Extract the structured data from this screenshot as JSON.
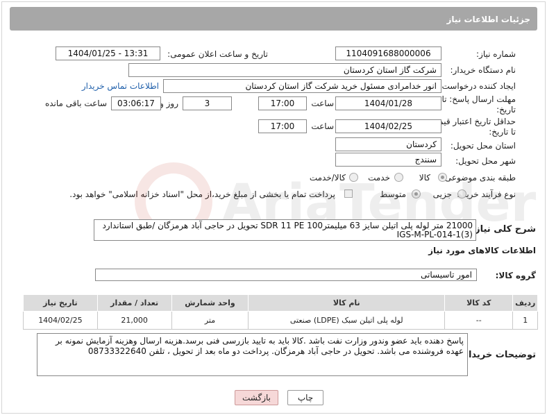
{
  "header": {
    "title": "جزئیات اطلاعات نیاز"
  },
  "fields": {
    "need_number_label": "شماره نیاز:",
    "need_number": "1104091688000006",
    "announce_label": "تاریخ و ساعت اعلان عمومی:",
    "announce_value": "1404/01/25 - 13:31",
    "buyer_org_label": "نام دستگاه خریدار:",
    "buyer_org": "شرکت گاز استان کردستان",
    "creator_label": "ایجاد کننده درخواست:",
    "creator": "انور خدامرادی مسئول خرید  شرکت گاز استان کردستان",
    "contact_link": "اطلاعات تماس خریدار",
    "deadline_label_1": "مهلت ارسال پاسخ: تا",
    "deadline_label_2": "تاریخ:",
    "deadline_date": "1404/01/28",
    "time_label": "ساعت",
    "deadline_time": "17:00",
    "days_value": "3",
    "days_label": "روز و",
    "remaining_time": "03:06:17",
    "remaining_label": "ساعت باقی مانده",
    "validity_label_1": "حداقل تاریخ اعتبار قیمت:",
    "validity_label_2": "تا تاریخ:",
    "validity_date": "1404/02/25",
    "validity_time": "17:00",
    "province_label": "استان محل تحویل:",
    "province": "کردستان",
    "city_label": "شهر محل تحویل:",
    "city": "سنندج",
    "category_label": "طبقه بندی موضوعی:",
    "category_options": [
      "کالا",
      "خدمت",
      "کالا/خدمت"
    ],
    "process_label": "نوع فرآیند خرید :",
    "process_options": [
      "جزیی",
      "متوسط"
    ],
    "payment_note": "پرداخت تمام یا بخشی از مبلغ خرید،از محل \"اسناد خزانه اسلامی\" خواهد بود."
  },
  "description": {
    "label": "شرح کلی نیاز:",
    "text": "21000 متر لوله پلی اتیلن سایز 63 میلیمترSDR 11  PE 100 تحویل در حاجی آباد هرمزگان /طبق استاندارد IGS-M-PL-014-1(3)"
  },
  "items_section": {
    "title": "اطلاعات کالاهای مورد نیاز",
    "group_label": "گروه کالا:",
    "group_value": "امور تاسیساتی",
    "columns": [
      "ردیف",
      "کد کالا",
      "نام کالا",
      "واحد شمارش",
      "تعداد / مقدار",
      "تاریخ نیاز"
    ],
    "rows": [
      [
        "1",
        "--",
        "لوله پلی اتیلن سبک (LDPE) صنعتی",
        "متر",
        "21,000",
        "1404/02/25"
      ]
    ]
  },
  "buyer_notes": {
    "label": "توضیحات خریدار:",
    "text": "پاسخ دهنده باید عضو وندور وزارت نفت باشد .کالا باید به تایید بازرسی فنی  برسد.هزینه ارسال وهزینه آزمایش نمونه بر عهده فروشنده می باشد. تحویل در حاجی آباد هرمزگان. پرداخت دو ماه بعد از تحویل ، تلفن 08733322640"
  },
  "buttons": {
    "print": "چاپ",
    "back": "بازگشت"
  }
}
